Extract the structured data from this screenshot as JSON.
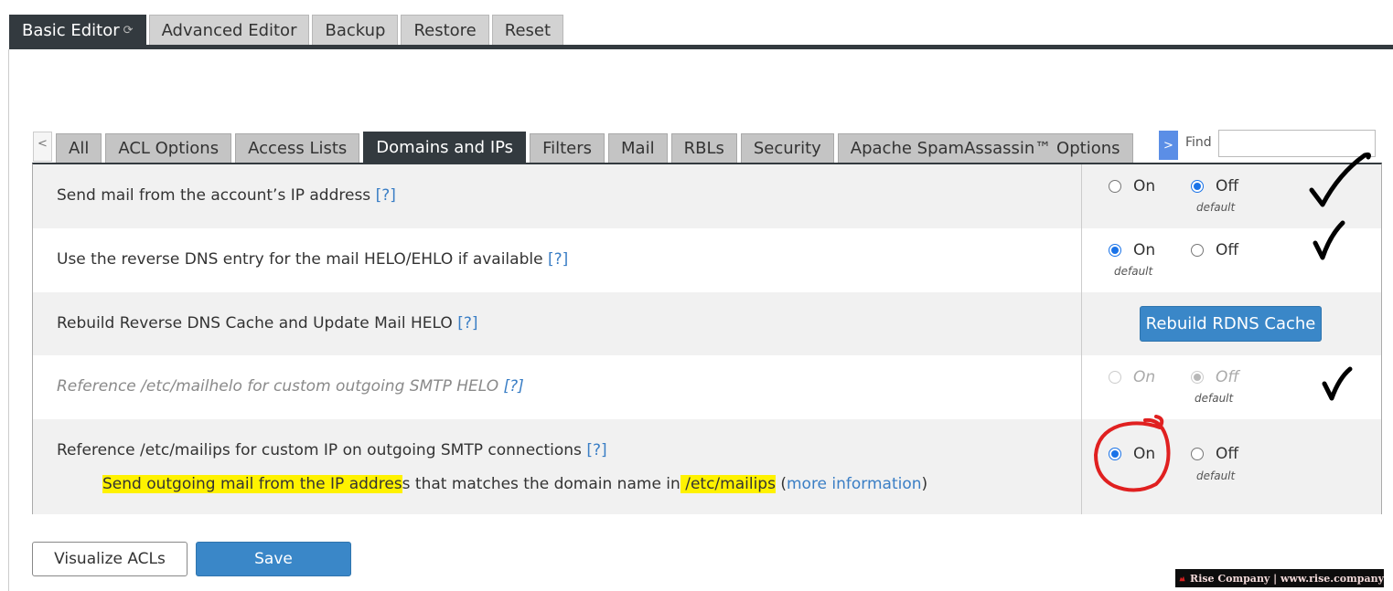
{
  "top_tabs": {
    "items": [
      {
        "label": "Basic Editor",
        "active": true
      },
      {
        "label": "Advanced Editor",
        "active": false
      },
      {
        "label": "Backup",
        "active": false
      },
      {
        "label": "Restore",
        "active": false
      },
      {
        "label": "Reset",
        "active": false
      }
    ],
    "refresh_icon": "refresh-icon"
  },
  "sub_tabs": {
    "scroll_left": "<",
    "items": [
      {
        "label": "All",
        "active": false
      },
      {
        "label": "ACL Options",
        "active": false
      },
      {
        "label": "Access Lists",
        "active": false
      },
      {
        "label": "Domains and IPs",
        "active": true
      },
      {
        "label": "Filters",
        "active": false
      },
      {
        "label": "Mail",
        "active": false
      },
      {
        "label": "RBLs",
        "active": false
      },
      {
        "label": "Security",
        "active": false
      },
      {
        "label": "Apache SpamAssassin™ Options",
        "active": false
      }
    ]
  },
  "find": {
    "toggle": ">",
    "label": "Find",
    "value": ""
  },
  "settings": [
    {
      "label": "Send mail from the account’s IP address",
      "help": "[?]",
      "options": [
        {
          "label": "On",
          "checked": false
        },
        {
          "label": "Off",
          "checked": true
        }
      ],
      "default_note": "default"
    },
    {
      "label": "Use the reverse DNS entry for the mail HELO/EHLO if available",
      "help": "[?]",
      "options": [
        {
          "label": "On",
          "checked": true
        },
        {
          "label": "Off",
          "checked": false
        }
      ],
      "default_note": "default"
    },
    {
      "label": "Rebuild Reverse DNS Cache and Update Mail HELO",
      "help": "[?]",
      "button": "Rebuild RDNS Cache"
    },
    {
      "label": "Reference /etc/mailhelo for custom outgoing SMTP HELO",
      "help": "[?]",
      "disabled": true,
      "options": [
        {
          "label": "On",
          "checked": false
        },
        {
          "label": "Off",
          "checked": true
        }
      ],
      "default_note": "default"
    },
    {
      "label": "Reference /etc/mailips for custom IP on outgoing SMTP connections",
      "help": "[?]",
      "options": [
        {
          "label": "On",
          "checked": true
        },
        {
          "label": "Off",
          "checked": false
        }
      ],
      "default_note": "default",
      "description": {
        "part1": "Send outgoing mail from the IP addres",
        "part2": "s that matches the domain name in",
        "part3": " /etc/mailips",
        "part4": " (",
        "link": "more information",
        "part5": ")"
      }
    }
  ],
  "buttons": {
    "visualize": "Visualize ACLs",
    "save": "Save"
  },
  "watermark": {
    "text": "Rise Company | www.rise.company"
  },
  "colors": {
    "accent": "#3a87c8",
    "dark": "#333a3f",
    "highlight": "#fff200",
    "annotation_red": "#e02020"
  }
}
